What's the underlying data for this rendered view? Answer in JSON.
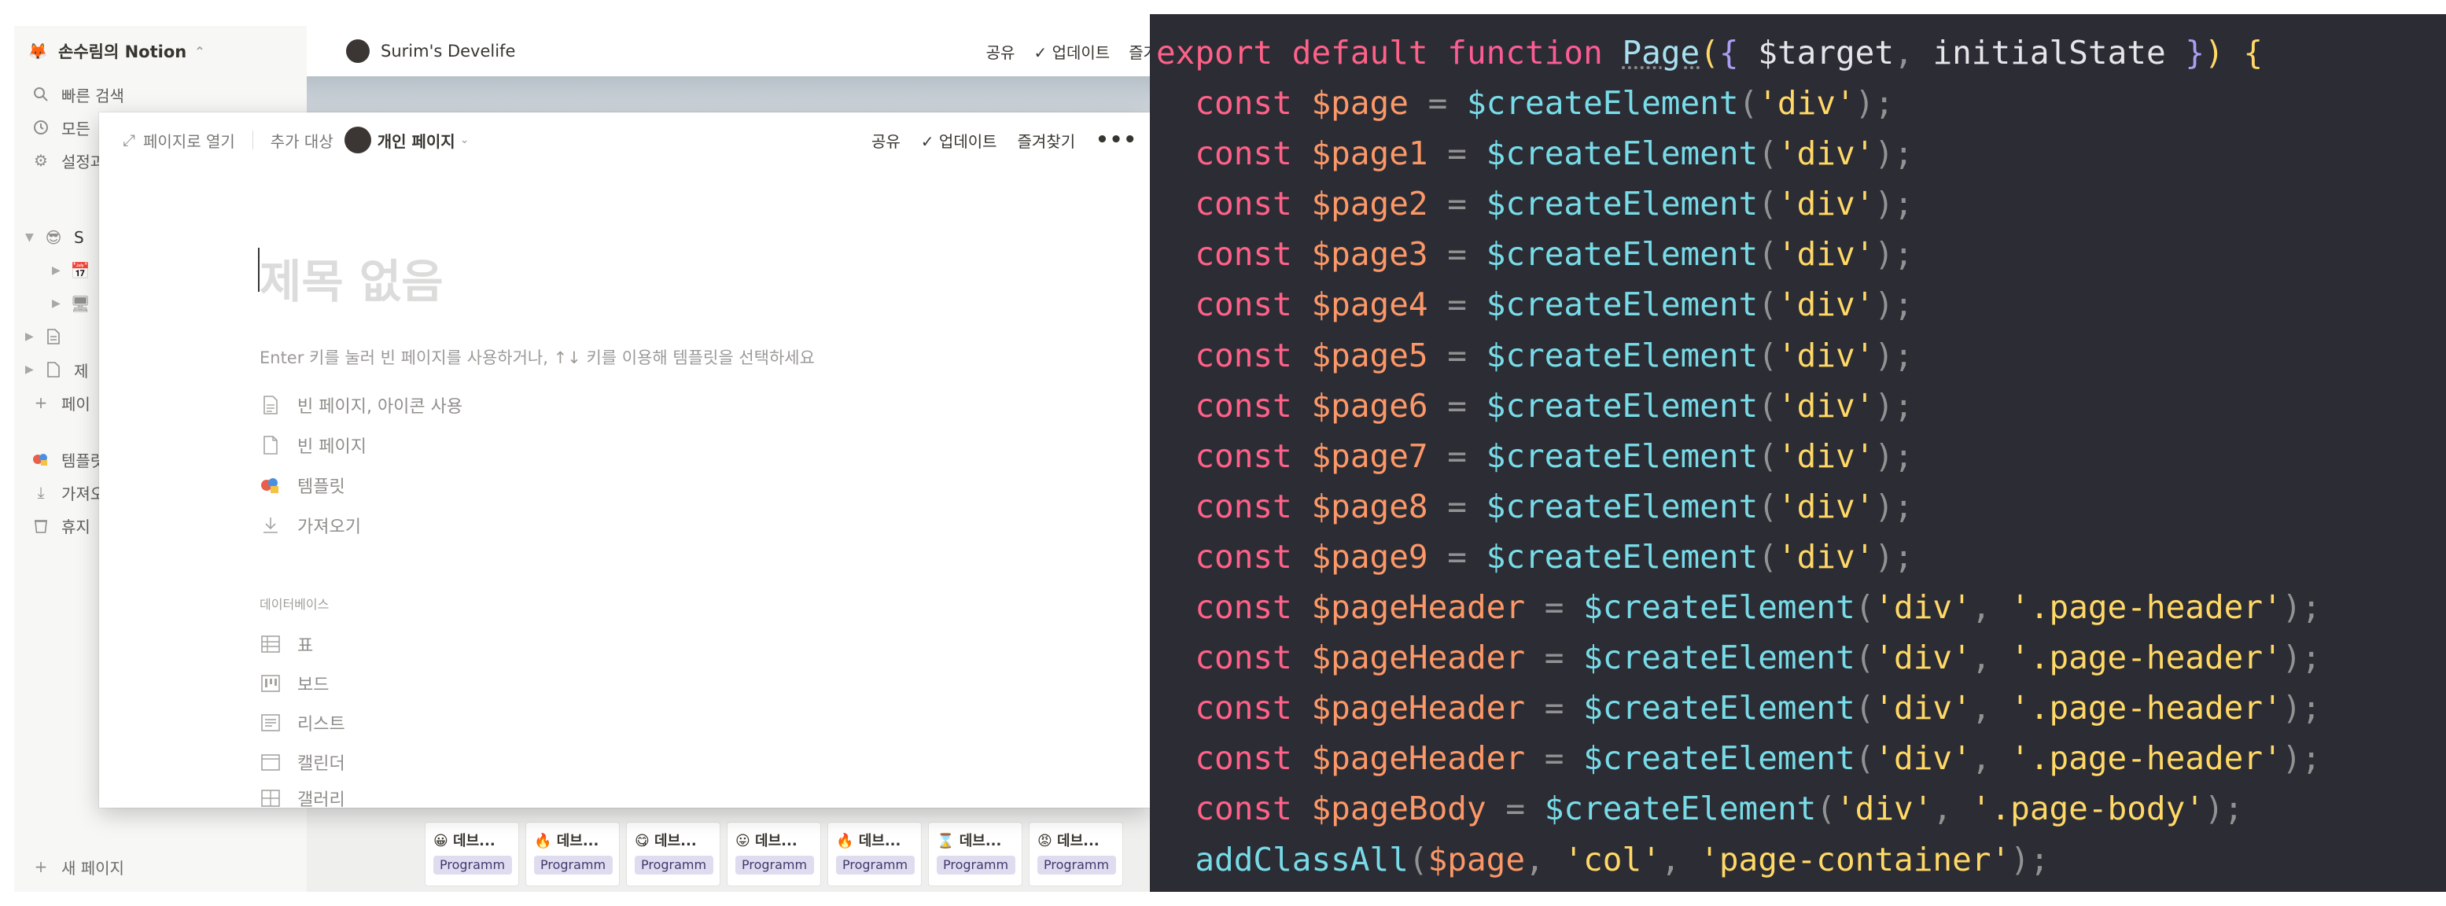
{
  "notion": {
    "workspace": {
      "name": "손수림의 Notion"
    },
    "sidebar": {
      "items": [
        {
          "label": "빠른 검색",
          "icon": "search-icon"
        },
        {
          "label": "모든",
          "icon": "clock-icon"
        },
        {
          "label": "설정과",
          "icon": "gear-icon"
        }
      ],
      "tree": [
        {
          "label": "S",
          "icon": "avatar-emoji"
        },
        {
          "label": "",
          "icon": "calendar-icon"
        },
        {
          "label": "",
          "icon": "image-icon"
        },
        {
          "label": "",
          "icon": "document-icon"
        },
        {
          "label": "제",
          "icon": "page-icon"
        },
        {
          "label": "페이",
          "icon": "plus-icon"
        }
      ],
      "lower": [
        {
          "label": "템플릿",
          "icon": "template-icon"
        },
        {
          "label": "가져오",
          "icon": "download-icon"
        },
        {
          "label": "휴지",
          "icon": "trash-icon"
        }
      ],
      "new_page": "새 페이지"
    },
    "main": {
      "page_title": "Surim's Develife",
      "actions": {
        "share": "공유",
        "updates": "업데이트",
        "favorite": "즐겨"
      }
    },
    "gallery": [
      {
        "title": "데브...",
        "emoji": "😀",
        "tag": "Programm"
      },
      {
        "title": "데브...",
        "emoji": "🔥",
        "tag": "Programm"
      },
      {
        "title": "데브...",
        "emoji": "😋",
        "tag": "Programm"
      },
      {
        "title": "데브...",
        "emoji": "😛",
        "tag": "Programm"
      },
      {
        "title": "데브...",
        "emoji": "🔥",
        "tag": "Programm"
      },
      {
        "title": "데브...",
        "emoji": "⌛",
        "tag": "Programm"
      },
      {
        "title": "데브...",
        "emoji": "😡",
        "tag": "Programm"
      }
    ],
    "modal": {
      "open_as_page": "페이지로 열기",
      "add_to": "추가 대상",
      "personal_page": "개인 페이지",
      "share": "공유",
      "updates": "업데이트",
      "favorite": "즐겨찾기",
      "title_placeholder": "제목 없음",
      "hint": "Enter 키를 눌러 빈 페이지를 사용하거나, ↑↓ 키를 이용해 템플릿을 선택하세요",
      "options": [
        {
          "label": "빈 페이지, 아이콘 사용",
          "icon": "page-emoji-icon"
        },
        {
          "label": "빈 페이지",
          "icon": "page-icon"
        },
        {
          "label": "템플릿",
          "icon": "template-icon"
        },
        {
          "label": "가져오기",
          "icon": "download-icon"
        }
      ],
      "database_heading": "데이터베이스",
      "database_options": [
        {
          "label": "표",
          "icon": "table-icon"
        },
        {
          "label": "보드",
          "icon": "board-icon"
        },
        {
          "label": "리스트",
          "icon": "list-icon"
        },
        {
          "label": "캘린더",
          "icon": "calendar-icon"
        },
        {
          "label": "갤러리",
          "icon": "gallery-icon"
        }
      ]
    }
  },
  "editor": {
    "lines": [
      [
        [
          "kw",
          "export "
        ],
        [
          "kw",
          "default "
        ],
        [
          "kw2",
          "function "
        ],
        [
          "page",
          "Page"
        ],
        [
          "brace",
          "("
        ],
        [
          "brace2",
          "{ "
        ],
        [
          "plain",
          "$target"
        ],
        [
          "punc",
          ", "
        ],
        [
          "plain",
          "initialState "
        ],
        [
          "brace2",
          "}"
        ],
        [
          "brace",
          ") "
        ],
        [
          "brace",
          "{"
        ]
      ],
      [
        [
          "plain",
          "  "
        ],
        [
          "const",
          "const "
        ],
        [
          "var",
          "$page "
        ],
        [
          "punc",
          "= "
        ],
        [
          "fn",
          "$createElement"
        ],
        [
          "punc",
          "("
        ],
        [
          "str",
          "'div'"
        ],
        [
          "punc",
          ");"
        ]
      ],
      [
        [
          "plain",
          "  "
        ],
        [
          "const",
          "const "
        ],
        [
          "var",
          "$page1 "
        ],
        [
          "punc",
          "= "
        ],
        [
          "fn",
          "$createElement"
        ],
        [
          "punc",
          "("
        ],
        [
          "str",
          "'div'"
        ],
        [
          "punc",
          ");"
        ]
      ],
      [
        [
          "plain",
          "  "
        ],
        [
          "const",
          "const "
        ],
        [
          "var",
          "$page2 "
        ],
        [
          "punc",
          "= "
        ],
        [
          "fn",
          "$createElement"
        ],
        [
          "punc",
          "("
        ],
        [
          "str",
          "'div'"
        ],
        [
          "punc",
          ");"
        ]
      ],
      [
        [
          "plain",
          "  "
        ],
        [
          "const",
          "const "
        ],
        [
          "var",
          "$page3 "
        ],
        [
          "punc",
          "= "
        ],
        [
          "fn",
          "$createElement"
        ],
        [
          "punc",
          "("
        ],
        [
          "str",
          "'div'"
        ],
        [
          "punc",
          ");"
        ]
      ],
      [
        [
          "plain",
          "  "
        ],
        [
          "const",
          "const "
        ],
        [
          "var",
          "$page4 "
        ],
        [
          "punc",
          "= "
        ],
        [
          "fn",
          "$createElement"
        ],
        [
          "punc",
          "("
        ],
        [
          "str",
          "'div'"
        ],
        [
          "punc",
          ");"
        ]
      ],
      [
        [
          "plain",
          "  "
        ],
        [
          "const",
          "const "
        ],
        [
          "var",
          "$page5 "
        ],
        [
          "punc",
          "= "
        ],
        [
          "fn",
          "$createElement"
        ],
        [
          "punc",
          "("
        ],
        [
          "str",
          "'div'"
        ],
        [
          "punc",
          ");"
        ]
      ],
      [
        [
          "plain",
          "  "
        ],
        [
          "const",
          "const "
        ],
        [
          "var",
          "$page6 "
        ],
        [
          "punc",
          "= "
        ],
        [
          "fn",
          "$createElement"
        ],
        [
          "punc",
          "("
        ],
        [
          "str",
          "'div'"
        ],
        [
          "punc",
          ");"
        ]
      ],
      [
        [
          "plain",
          "  "
        ],
        [
          "const",
          "const "
        ],
        [
          "var",
          "$page7 "
        ],
        [
          "punc",
          "= "
        ],
        [
          "fn",
          "$createElement"
        ],
        [
          "punc",
          "("
        ],
        [
          "str",
          "'div'"
        ],
        [
          "punc",
          ");"
        ]
      ],
      [
        [
          "plain",
          "  "
        ],
        [
          "const",
          "const "
        ],
        [
          "var",
          "$page8 "
        ],
        [
          "punc",
          "= "
        ],
        [
          "fn",
          "$createElement"
        ],
        [
          "punc",
          "("
        ],
        [
          "str",
          "'div'"
        ],
        [
          "punc",
          ");"
        ]
      ],
      [
        [
          "plain",
          "  "
        ],
        [
          "const",
          "const "
        ],
        [
          "var",
          "$page9 "
        ],
        [
          "punc",
          "= "
        ],
        [
          "fn",
          "$createElement"
        ],
        [
          "punc",
          "("
        ],
        [
          "str",
          "'div'"
        ],
        [
          "punc",
          ");"
        ]
      ],
      [
        [
          "plain",
          "  "
        ],
        [
          "const",
          "const "
        ],
        [
          "var",
          "$pageHeader "
        ],
        [
          "punc",
          "= "
        ],
        [
          "fn",
          "$createElement"
        ],
        [
          "punc",
          "("
        ],
        [
          "str",
          "'div'"
        ],
        [
          "punc",
          ", "
        ],
        [
          "str",
          "'.page-header'"
        ],
        [
          "punc",
          ");"
        ]
      ],
      [
        [
          "plain",
          "  "
        ],
        [
          "const",
          "const "
        ],
        [
          "var",
          "$pageHeader "
        ],
        [
          "punc",
          "= "
        ],
        [
          "fn",
          "$createElement"
        ],
        [
          "punc",
          "("
        ],
        [
          "str",
          "'div'"
        ],
        [
          "punc",
          ", "
        ],
        [
          "str",
          "'.page-header'"
        ],
        [
          "punc",
          ");"
        ]
      ],
      [
        [
          "plain",
          "  "
        ],
        [
          "const",
          "const "
        ],
        [
          "var",
          "$pageHeader "
        ],
        [
          "punc",
          "= "
        ],
        [
          "fn",
          "$createElement"
        ],
        [
          "punc",
          "("
        ],
        [
          "str",
          "'div'"
        ],
        [
          "punc",
          ", "
        ],
        [
          "str",
          "'.page-header'"
        ],
        [
          "punc",
          ");"
        ]
      ],
      [
        [
          "plain",
          "  "
        ],
        [
          "const",
          "const "
        ],
        [
          "var",
          "$pageHeader "
        ],
        [
          "punc",
          "= "
        ],
        [
          "fn",
          "$createElement"
        ],
        [
          "punc",
          "("
        ],
        [
          "str",
          "'div'"
        ],
        [
          "punc",
          ", "
        ],
        [
          "str",
          "'.page-header'"
        ],
        [
          "punc",
          ");"
        ]
      ],
      [
        [
          "plain",
          "  "
        ],
        [
          "const",
          "const "
        ],
        [
          "var",
          "$pageBody "
        ],
        [
          "punc",
          "= "
        ],
        [
          "fn",
          "$createElement"
        ],
        [
          "punc",
          "("
        ],
        [
          "str",
          "'div'"
        ],
        [
          "punc",
          ", "
        ],
        [
          "str",
          "'.page-body'"
        ],
        [
          "punc",
          ");"
        ]
      ],
      [
        [
          "plain",
          "  "
        ],
        [
          "fn",
          "addClassAll"
        ],
        [
          "punc",
          "("
        ],
        [
          "var",
          "$page"
        ],
        [
          "punc",
          ", "
        ],
        [
          "str",
          "'col'"
        ],
        [
          "punc",
          ", "
        ],
        [
          "str",
          "'page-container'"
        ],
        [
          "punc",
          ");"
        ]
      ]
    ]
  }
}
